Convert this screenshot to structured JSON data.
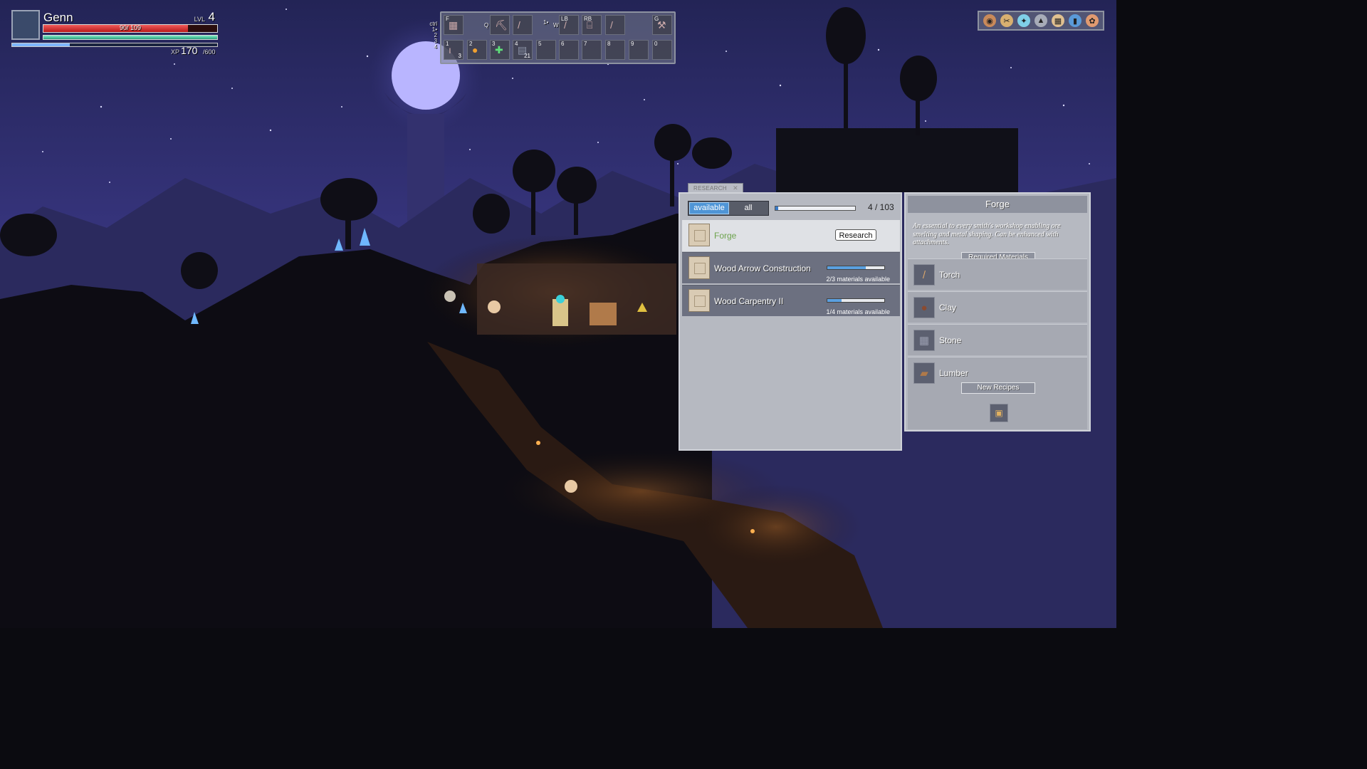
{
  "player": {
    "name": "Genn",
    "level_label": "LVL",
    "level": "4",
    "hp_text": "90/ 109",
    "hp_fraction": 0.83,
    "stamina_fraction": 1.0,
    "xp_label": "XP",
    "xp_value": "170",
    "xp_max": "/600",
    "xp_fraction": 0.28
  },
  "hotbar": {
    "ctrl_label": "ctrl",
    "row_numbers": [
      "1•",
      "2",
      "3",
      "4"
    ],
    "top_keys": [
      "F",
      "Q",
      "1•",
      "W",
      "LB",
      "RB",
      "G"
    ],
    "slots": [
      {
        "key": "1",
        "count": "3",
        "icon": "torch-icon"
      },
      {
        "key": "2",
        "count": "",
        "icon": "fire-orb-icon"
      },
      {
        "key": "3",
        "count": "",
        "icon": "heal-cross-icon"
      },
      {
        "key": "4",
        "count": "21",
        "icon": "stone-block-icon"
      },
      {
        "key": "5",
        "count": "",
        "icon": ""
      },
      {
        "key": "6",
        "count": "",
        "icon": ""
      },
      {
        "key": "7",
        "count": "",
        "icon": ""
      },
      {
        "key": "8",
        "count": "",
        "icon": ""
      },
      {
        "key": "9",
        "count": "",
        "icon": ""
      },
      {
        "key": "0",
        "count": "",
        "icon": ""
      }
    ]
  },
  "menu_icons": [
    "inventory-icon",
    "crafting-icon",
    "research-icon",
    "ship-icon",
    "map-icon",
    "journal-icon",
    "settings-icon"
  ],
  "research": {
    "tab_label": "RESEARCH",
    "filter_available": "available",
    "filter_all": "all",
    "progress_text": "4 / 103",
    "progress_fraction": 0.039,
    "items": [
      {
        "name": "Forge",
        "button": "Research",
        "selected": true
      },
      {
        "name": "Wood Arrow Construction",
        "materials": "2/3 materials available",
        "fraction": 0.67
      },
      {
        "name": "Wood Carpentry II",
        "materials": "1/4 materials available",
        "fraction": 0.25
      }
    ]
  },
  "detail": {
    "title": "Forge",
    "description": "An essential to every smith's workshop enabling ore smelting and metal shaping. Can be enhanced with attachments.",
    "required_label": "Required Materials",
    "materials": [
      {
        "name": "Torch",
        "icon": "torch-icon"
      },
      {
        "name": "Clay",
        "icon": "clay-icon"
      },
      {
        "name": "Stone",
        "icon": "stone-icon"
      },
      {
        "name": "Lumber",
        "icon": "lumber-icon"
      }
    ],
    "new_recipes_label": "New Recipes",
    "recipe_icon": "forge-icon"
  },
  "colors": {
    "sky_top": "#2b2a62",
    "sky_mid": "#3d3a86",
    "moon": "#b9b5ff",
    "accent_blue": "#4f95d6",
    "forge_green": "#6da34d",
    "panel_bg": "#b6b9c1"
  }
}
